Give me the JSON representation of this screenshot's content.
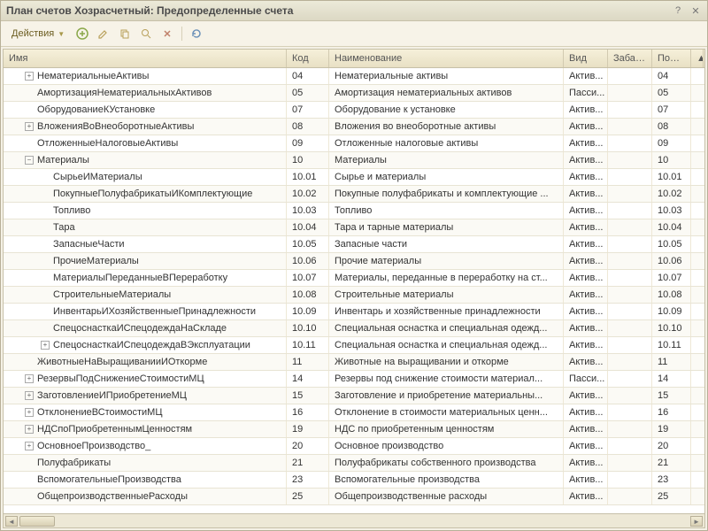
{
  "title": "План счетов Хозрасчетный: Предопределенные счета",
  "toolbar": {
    "actions": "Действия"
  },
  "columns": {
    "name": "Имя",
    "code": "Код",
    "desc": "Наименование",
    "type": "Вид",
    "bal": "Забал...",
    "ord": "Поряд..."
  },
  "rows": [
    {
      "indent": 1,
      "toggle": "plus",
      "name": "НематериальныеАктивы",
      "code": "04",
      "desc": "Нематериальные активы",
      "type": "Актив...",
      "bal": "",
      "ord": "04"
    },
    {
      "indent": 1,
      "toggle": "none",
      "name": "АмортизацияНематериальныхАктивов",
      "code": "05",
      "desc": "Амортизация нематериальных активов",
      "type": "Пасси...",
      "bal": "",
      "ord": "05"
    },
    {
      "indent": 1,
      "toggle": "none",
      "name": "ОборудованиеКУстановке",
      "code": "07",
      "desc": "Оборудование к установке",
      "type": "Актив...",
      "bal": "",
      "ord": "07"
    },
    {
      "indent": 1,
      "toggle": "plus",
      "name": "ВложенияВоВнеоборотныеАктивы",
      "code": "08",
      "desc": "Вложения во внеоборотные активы",
      "type": "Актив...",
      "bal": "",
      "ord": "08"
    },
    {
      "indent": 1,
      "toggle": "none",
      "name": "ОтложенныеНалоговыеАктивы",
      "code": "09",
      "desc": "Отложенные налоговые активы",
      "type": "Актив...",
      "bal": "",
      "ord": "09"
    },
    {
      "indent": 1,
      "toggle": "minus",
      "name": "Материалы",
      "code": "10",
      "desc": "Материалы",
      "type": "Актив...",
      "bal": "",
      "ord": "10"
    },
    {
      "indent": 2,
      "toggle": "none",
      "name": "СырьеИМатериалы",
      "code": "10.01",
      "desc": "Сырье и материалы",
      "type": "Актив...",
      "bal": "",
      "ord": "10.01"
    },
    {
      "indent": 2,
      "toggle": "none",
      "name": "ПокупныеПолуфабрикатыИКомплектующие",
      "code": "10.02",
      "desc": "Покупные полуфабрикаты и комплектующие ...",
      "type": "Актив...",
      "bal": "",
      "ord": "10.02"
    },
    {
      "indent": 2,
      "toggle": "none",
      "name": "Топливо",
      "code": "10.03",
      "desc": "Топливо",
      "type": "Актив...",
      "bal": "",
      "ord": "10.03"
    },
    {
      "indent": 2,
      "toggle": "none",
      "name": "Тара",
      "code": "10.04",
      "desc": "Тара и тарные материалы",
      "type": "Актив...",
      "bal": "",
      "ord": "10.04"
    },
    {
      "indent": 2,
      "toggle": "none",
      "name": "ЗапасныеЧасти",
      "code": "10.05",
      "desc": "Запасные части",
      "type": "Актив...",
      "bal": "",
      "ord": "10.05"
    },
    {
      "indent": 2,
      "toggle": "none",
      "name": "ПрочиеМатериалы",
      "code": "10.06",
      "desc": "Прочие материалы",
      "type": "Актив...",
      "bal": "",
      "ord": "10.06"
    },
    {
      "indent": 2,
      "toggle": "none",
      "name": "МатериалыПереданныеВПереработку",
      "code": "10.07",
      "desc": "Материалы, переданные в переработку на ст...",
      "type": "Актив...",
      "bal": "",
      "ord": "10.07"
    },
    {
      "indent": 2,
      "toggle": "none",
      "name": "СтроительныеМатериалы",
      "code": "10.08",
      "desc": "Строительные материалы",
      "type": "Актив...",
      "bal": "",
      "ord": "10.08"
    },
    {
      "indent": 2,
      "toggle": "none",
      "name": "ИнвентарьИХозяйственныеПринадлежности",
      "code": "10.09",
      "desc": "Инвентарь и хозяйственные принадлежности",
      "type": "Актив...",
      "bal": "",
      "ord": "10.09"
    },
    {
      "indent": 2,
      "toggle": "none",
      "name": "СпецоснасткаИСпецодеждаНаСкладе",
      "code": "10.10",
      "desc": "Специальная оснастка и специальная одежд...",
      "type": "Актив...",
      "bal": "",
      "ord": "10.10"
    },
    {
      "indent": 2,
      "toggle": "plus",
      "name": "СпецоснасткаИСпецодеждаВЭксплуатации",
      "code": "10.11",
      "desc": "Специальная оснастка и специальная одежд...",
      "type": "Актив...",
      "bal": "",
      "ord": "10.11"
    },
    {
      "indent": 1,
      "toggle": "none",
      "name": "ЖивотныеНаВыращиванииИОткорме",
      "code": "11",
      "desc": "Животные на выращивании и откорме",
      "type": "Актив...",
      "bal": "",
      "ord": "11"
    },
    {
      "indent": 1,
      "toggle": "plus",
      "name": "РезервыПодСнижениеСтоимостиМЦ",
      "code": "14",
      "desc": "Резервы под снижение стоимости материал...",
      "type": "Пасси...",
      "bal": "",
      "ord": "14"
    },
    {
      "indent": 1,
      "toggle": "plus",
      "name": "ЗаготовлениеИПриобретениеМЦ",
      "code": "15",
      "desc": "Заготовление и приобретение материальны...",
      "type": "Актив...",
      "bal": "",
      "ord": "15"
    },
    {
      "indent": 1,
      "toggle": "plus",
      "name": "ОтклонениеВСтоимостиМЦ",
      "code": "16",
      "desc": "Отклонение в стоимости материальных ценн...",
      "type": "Актив...",
      "bal": "",
      "ord": "16"
    },
    {
      "indent": 1,
      "toggle": "plus",
      "name": "НДСпоПриобретеннымЦенностям",
      "code": "19",
      "desc": "НДС по приобретенным ценностям",
      "type": "Актив...",
      "bal": "",
      "ord": "19"
    },
    {
      "indent": 1,
      "toggle": "plus",
      "name": "ОсновноеПроизводство_",
      "code": "20",
      "desc": "Основное производство",
      "type": "Актив...",
      "bal": "",
      "ord": "20"
    },
    {
      "indent": 1,
      "toggle": "none",
      "name": "Полуфабрикаты",
      "code": "21",
      "desc": "Полуфабрикаты собственного производства",
      "type": "Актив...",
      "bal": "",
      "ord": "21"
    },
    {
      "indent": 1,
      "toggle": "none",
      "name": "ВспомогательныеПроизводства",
      "code": "23",
      "desc": "Вспомогательные производства",
      "type": "Актив...",
      "bal": "",
      "ord": "23"
    },
    {
      "indent": 1,
      "toggle": "none",
      "name": "ОбщепроизводственныеРасходы",
      "code": "25",
      "desc": "Общепроизводственные расходы",
      "type": "Актив...",
      "bal": "",
      "ord": "25"
    }
  ]
}
